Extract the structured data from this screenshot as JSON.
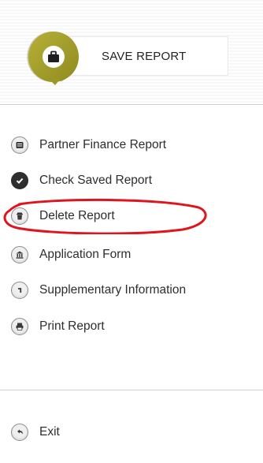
{
  "header": {
    "save_label": "SAVE REPORT"
  },
  "menu": {
    "items": [
      {
        "label": "Partner Finance Report",
        "icon": "list-icon"
      },
      {
        "label": "Check Saved Report",
        "icon": "check-icon"
      },
      {
        "label": "Delete Report",
        "icon": "trash-icon"
      },
      {
        "label": "Application Form",
        "icon": "bank-icon"
      },
      {
        "label": "Supplementary Information",
        "icon": "info-icon"
      },
      {
        "label": "Print Report",
        "icon": "printer-icon"
      }
    ]
  },
  "exit": {
    "label": "Exit",
    "icon": "back-arrow-icon"
  },
  "colors": {
    "badge_olive": "#a7a12c",
    "highlight_red": "#e0141c"
  }
}
